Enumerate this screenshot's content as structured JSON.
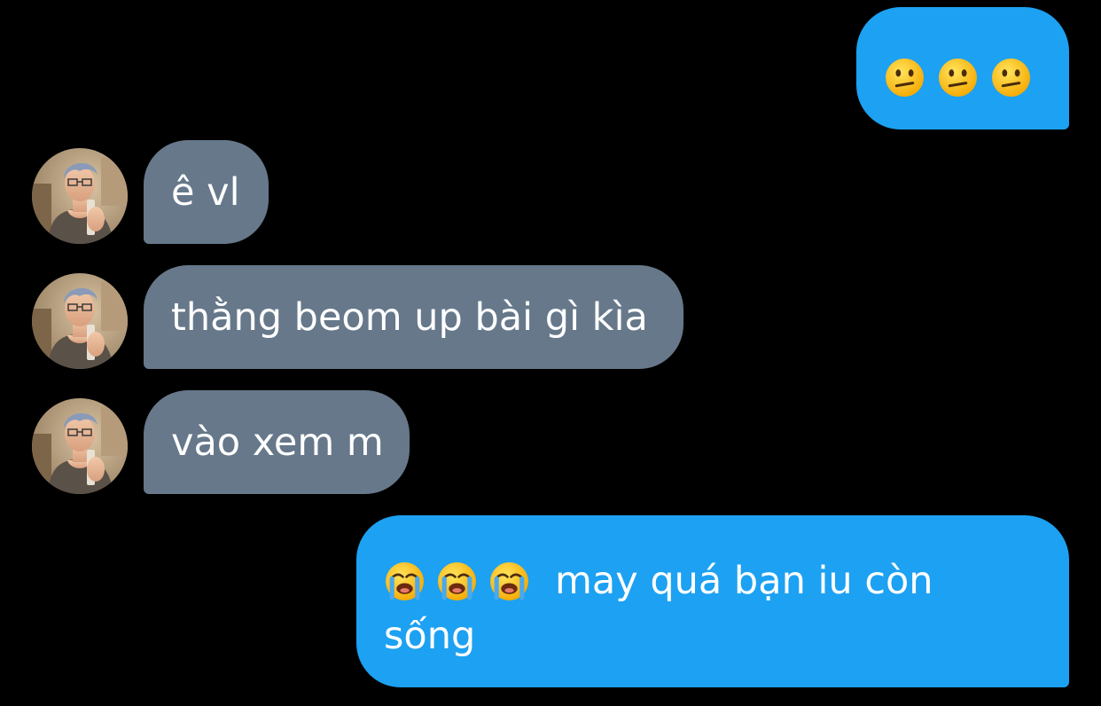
{
  "colors": {
    "background": "#000000",
    "outgoing_bubble": "#1da1f2",
    "incoming_bubble": "#66788a",
    "text": "#ffffff"
  },
  "messages": [
    {
      "direction": "outgoing",
      "emojis": [
        "confused-face-icon",
        "confused-face-icon",
        "confused-face-icon"
      ],
      "text": ""
    },
    {
      "direction": "incoming",
      "text": "ê vl"
    },
    {
      "direction": "incoming",
      "text": "thằng beom up bài gì kìa"
    },
    {
      "direction": "incoming",
      "text": "vào xem m"
    },
    {
      "direction": "outgoing",
      "emojis": [
        "loudly-crying-face-icon",
        "loudly-crying-face-icon",
        "loudly-crying-face-icon"
      ],
      "text_line1": "may quá bạn iu còn",
      "text_line2": "sống"
    }
  ]
}
